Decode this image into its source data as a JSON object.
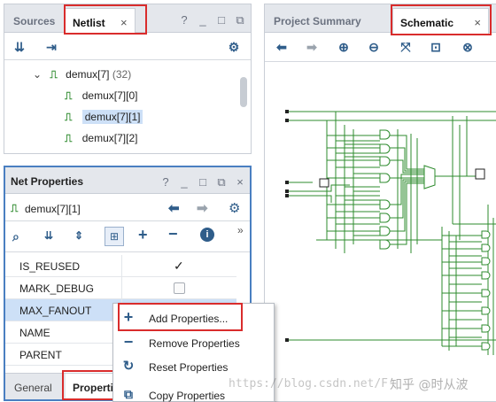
{
  "netlist_panel": {
    "tabs": [
      {
        "label": "Sources"
      },
      {
        "label": "Netlist"
      }
    ],
    "close_glyph": "×",
    "help_glyph": "?",
    "tree": {
      "parent_label": "demux[7]",
      "parent_count": "(32)",
      "children": [
        {
          "label": "demux[7][0]"
        },
        {
          "label": "demux[7][1]"
        },
        {
          "label": "demux[7][2]"
        }
      ]
    }
  },
  "props_panel": {
    "title": "Net Properties",
    "help_glyph": "?",
    "net_name": "demux[7][1]",
    "more_glyph": "»",
    "rows": [
      {
        "key": "IS_REUSED"
      },
      {
        "key": "MARK_DEBUG"
      },
      {
        "key": "MAX_FANOUT"
      },
      {
        "key": "NAME"
      },
      {
        "key": "PARENT"
      }
    ],
    "checkmark": "✓",
    "bottom_tabs": [
      {
        "label": "General"
      },
      {
        "label": "Properti"
      }
    ]
  },
  "context_menu": {
    "items": [
      {
        "label": "Add Properties...",
        "icon": "plus-icon"
      },
      {
        "label": "Remove Properties",
        "icon": "minus-icon"
      },
      {
        "label": "Reset Properties",
        "icon": "reset-icon"
      },
      {
        "label": "Copy Properties",
        "icon": "copy-icon"
      }
    ]
  },
  "schematic_panel": {
    "tabs": [
      {
        "label": "Project Summary"
      },
      {
        "label": "Schematic"
      }
    ],
    "close_glyph": "×"
  },
  "watermark": {
    "text": "https://blog.csdn.net/F",
    "brand": "知乎 @时从波"
  },
  "colors": {
    "accent_red": "#d92c2c",
    "selection": "#cde0f7",
    "icon_blue": "#2f5d8a",
    "wire_green": "#2e8b2e"
  }
}
